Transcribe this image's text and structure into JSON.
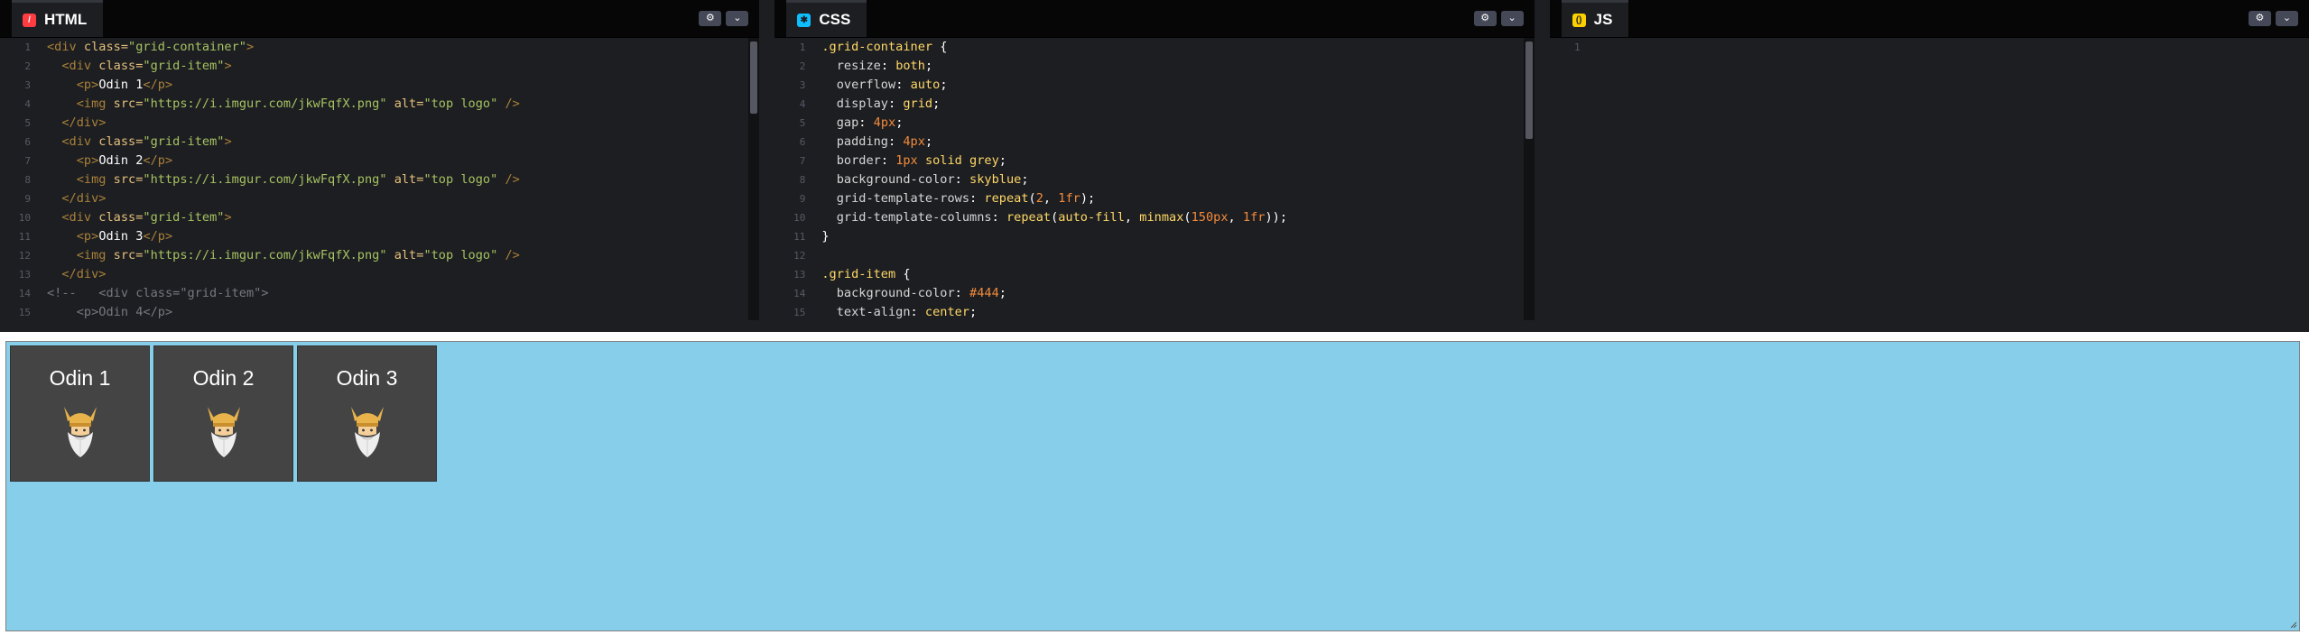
{
  "editors": {
    "html": {
      "tab_label": "HTML",
      "icon": "html-icon",
      "icon_color": "#ff3c41",
      "lines": [
        {
          "n": "1",
          "fold": true,
          "parts": [
            [
              "tag",
              "<div "
            ],
            [
              "attr",
              "class="
            ],
            [
              "str",
              "\"grid-container\""
            ],
            [
              "tag",
              ">"
            ]
          ]
        },
        {
          "n": "2",
          "fold": true,
          "parts": [
            [
              "plain",
              "  "
            ],
            [
              "tag",
              "<div "
            ],
            [
              "attr",
              "class="
            ],
            [
              "str",
              "\"grid-item\""
            ],
            [
              "tag",
              ">"
            ]
          ]
        },
        {
          "n": "3",
          "fold": true,
          "parts": [
            [
              "plain",
              "    "
            ],
            [
              "tag",
              "<p>"
            ],
            [
              "txt",
              "Odin 1"
            ],
            [
              "tag",
              "</p>"
            ]
          ]
        },
        {
          "n": "4",
          "fold": false,
          "parts": [
            [
              "plain",
              "    "
            ],
            [
              "tag",
              "<img "
            ],
            [
              "attr",
              "src="
            ],
            [
              "str",
              "\"https://i.imgur.com/jkwFqfX.png\""
            ],
            [
              "plain",
              " "
            ],
            [
              "attr",
              "alt="
            ],
            [
              "str",
              "\"top logo\""
            ],
            [
              "tag",
              " />"
            ]
          ]
        },
        {
          "n": "5",
          "fold": false,
          "parts": [
            [
              "plain",
              "  "
            ],
            [
              "tag",
              "</div>"
            ]
          ]
        },
        {
          "n": "6",
          "fold": true,
          "parts": [
            [
              "plain",
              "  "
            ],
            [
              "tag",
              "<div "
            ],
            [
              "attr",
              "class="
            ],
            [
              "str",
              "\"grid-item\""
            ],
            [
              "tag",
              ">"
            ]
          ]
        },
        {
          "n": "7",
          "fold": true,
          "parts": [
            [
              "plain",
              "    "
            ],
            [
              "tag",
              "<p>"
            ],
            [
              "txt",
              "Odin 2"
            ],
            [
              "tag",
              "</p>"
            ]
          ]
        },
        {
          "n": "8",
          "fold": false,
          "parts": [
            [
              "plain",
              "    "
            ],
            [
              "tag",
              "<img "
            ],
            [
              "attr",
              "src="
            ],
            [
              "str",
              "\"https://i.imgur.com/jkwFqfX.png\""
            ],
            [
              "plain",
              " "
            ],
            [
              "attr",
              "alt="
            ],
            [
              "str",
              "\"top logo\""
            ],
            [
              "tag",
              " />"
            ]
          ]
        },
        {
          "n": "9",
          "fold": false,
          "parts": [
            [
              "plain",
              "  "
            ],
            [
              "tag",
              "</div>"
            ]
          ]
        },
        {
          "n": "10",
          "fold": true,
          "parts": [
            [
              "plain",
              "  "
            ],
            [
              "tag",
              "<div "
            ],
            [
              "attr",
              "class="
            ],
            [
              "str",
              "\"grid-item\""
            ],
            [
              "tag",
              ">"
            ]
          ]
        },
        {
          "n": "11",
          "fold": true,
          "parts": [
            [
              "plain",
              "    "
            ],
            [
              "tag",
              "<p>"
            ],
            [
              "txt",
              "Odin 3"
            ],
            [
              "tag",
              "</p>"
            ]
          ]
        },
        {
          "n": "12",
          "fold": false,
          "parts": [
            [
              "plain",
              "    "
            ],
            [
              "tag",
              "<img "
            ],
            [
              "attr",
              "src="
            ],
            [
              "str",
              "\"https://i.imgur.com/jkwFqfX.png\""
            ],
            [
              "plain",
              " "
            ],
            [
              "attr",
              "alt="
            ],
            [
              "str",
              "\"top logo\""
            ],
            [
              "tag",
              " />"
            ]
          ]
        },
        {
          "n": "13",
          "fold": false,
          "parts": [
            [
              "plain",
              "  "
            ],
            [
              "tag",
              "</div>"
            ]
          ]
        },
        {
          "n": "14",
          "fold": true,
          "parts": [
            [
              "cmt",
              "<!--   <div class=\"grid-item\">"
            ]
          ]
        },
        {
          "n": "15",
          "fold": false,
          "parts": [
            [
              "cmt",
              "    <p>Odin 4</p>"
            ]
          ]
        }
      ]
    },
    "css": {
      "tab_label": "CSS",
      "icon": "css-icon",
      "icon_color": "#0ebeff",
      "lines": [
        {
          "n": "1",
          "fold": true,
          "parts": [
            [
              "sel",
              ".grid-container"
            ],
            [
              "punc",
              " {"
            ]
          ]
        },
        {
          "n": "2",
          "fold": false,
          "parts": [
            [
              "plain",
              "  "
            ],
            [
              "prop",
              "resize"
            ],
            [
              "punc",
              ": "
            ],
            [
              "val",
              "both"
            ],
            [
              "punc",
              ";"
            ]
          ]
        },
        {
          "n": "3",
          "fold": false,
          "parts": [
            [
              "plain",
              "  "
            ],
            [
              "prop",
              "overflow"
            ],
            [
              "punc",
              ": "
            ],
            [
              "val",
              "auto"
            ],
            [
              "punc",
              ";"
            ]
          ]
        },
        {
          "n": "4",
          "fold": false,
          "parts": [
            [
              "plain",
              "  "
            ],
            [
              "prop",
              "display"
            ],
            [
              "punc",
              ": "
            ],
            [
              "val",
              "grid"
            ],
            [
              "punc",
              ";"
            ]
          ]
        },
        {
          "n": "5",
          "fold": false,
          "parts": [
            [
              "plain",
              "  "
            ],
            [
              "prop",
              "gap"
            ],
            [
              "punc",
              ": "
            ],
            [
              "num",
              "4px"
            ],
            [
              "punc",
              ";"
            ]
          ]
        },
        {
          "n": "6",
          "fold": false,
          "parts": [
            [
              "plain",
              "  "
            ],
            [
              "prop",
              "padding"
            ],
            [
              "punc",
              ": "
            ],
            [
              "num",
              "4px"
            ],
            [
              "punc",
              ";"
            ]
          ]
        },
        {
          "n": "7",
          "fold": false,
          "parts": [
            [
              "plain",
              "  "
            ],
            [
              "prop",
              "border"
            ],
            [
              "punc",
              ": "
            ],
            [
              "num",
              "1px"
            ],
            [
              "plain",
              " "
            ],
            [
              "val",
              "solid grey"
            ],
            [
              "punc",
              ";"
            ]
          ]
        },
        {
          "n": "8",
          "fold": false,
          "parts": [
            [
              "plain",
              "  "
            ],
            [
              "prop",
              "background-color"
            ],
            [
              "punc",
              ": "
            ],
            [
              "val",
              "skyblue"
            ],
            [
              "punc",
              ";"
            ]
          ]
        },
        {
          "n": "9",
          "fold": false,
          "parts": [
            [
              "plain",
              "  "
            ],
            [
              "prop",
              "grid-template-rows"
            ],
            [
              "punc",
              ": "
            ],
            [
              "fn",
              "repeat"
            ],
            [
              "punc",
              "("
            ],
            [
              "num",
              "2"
            ],
            [
              "punc",
              ", "
            ],
            [
              "num",
              "1fr"
            ],
            [
              "punc",
              ");"
            ]
          ]
        },
        {
          "n": "10",
          "fold": false,
          "parts": [
            [
              "plain",
              "  "
            ],
            [
              "prop",
              "grid-template-columns"
            ],
            [
              "punc",
              ": "
            ],
            [
              "fn",
              "repeat"
            ],
            [
              "punc",
              "("
            ],
            [
              "val",
              "auto-fill"
            ],
            [
              "punc",
              ", "
            ],
            [
              "fn",
              "minmax"
            ],
            [
              "punc",
              "("
            ],
            [
              "num",
              "150px"
            ],
            [
              "punc",
              ", "
            ],
            [
              "num",
              "1fr"
            ],
            [
              "punc",
              "));"
            ]
          ]
        },
        {
          "n": "11",
          "fold": false,
          "parts": [
            [
              "punc",
              "}"
            ]
          ]
        },
        {
          "n": "12",
          "fold": false,
          "parts": []
        },
        {
          "n": "13",
          "fold": true,
          "parts": [
            [
              "sel",
              ".grid-item"
            ],
            [
              "punc",
              " {"
            ]
          ]
        },
        {
          "n": "14",
          "fold": false,
          "parts": [
            [
              "plain",
              "  "
            ],
            [
              "prop",
              "background-color"
            ],
            [
              "punc",
              ": "
            ],
            [
              "num",
              "#444"
            ],
            [
              "punc",
              ";"
            ]
          ]
        },
        {
          "n": "15",
          "fold": false,
          "parts": [
            [
              "plain",
              "  "
            ],
            [
              "prop",
              "text-align"
            ],
            [
              "punc",
              ": "
            ],
            [
              "val",
              "center"
            ],
            [
              "punc",
              ";"
            ]
          ]
        }
      ]
    },
    "js": {
      "tab_label": "JS",
      "icon": "js-icon",
      "icon_color": "#fcd000",
      "lines": [
        {
          "n": "1",
          "fold": false,
          "parts": []
        }
      ]
    },
    "settings_icon": "gear-icon",
    "collapse_icon": "chevron-down-icon"
  },
  "result": {
    "items": [
      {
        "label": "Odin 1",
        "image_alt": "top logo"
      },
      {
        "label": "Odin 2",
        "image_alt": "top logo"
      },
      {
        "label": "Odin 3",
        "image_alt": "top logo"
      }
    ]
  }
}
